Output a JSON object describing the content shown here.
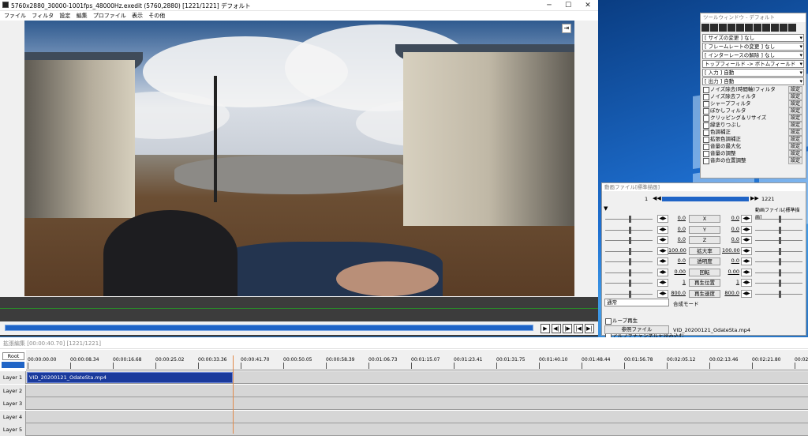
{
  "main": {
    "title": "5760x2880_30000-1001fps_48000Hz.exedit (5760,2880)  [1221/1221]  デフォルト",
    "menu": [
      "ファイル",
      "フィルタ",
      "設定",
      "編集",
      "プロファイル",
      "表示",
      "その他"
    ],
    "controls": {
      "minimize": "─",
      "maximize": "☐",
      "close": "✕"
    }
  },
  "toolwin": {
    "title": "ツールウィンドウ - デフォルト",
    "selects": [
      "[ サイズの変更 ]  なし",
      "[ フレームレートの変更 ]  なし",
      "[ インターレースの解除 ]  なし",
      "トップフィールド -> ボトムフィールド",
      "[ 入力 ]  自動",
      "[ 出力 ]  自動"
    ],
    "filters": [
      "ノイズ除去(時間軸)フィルタ",
      "ノイズ除去フィルタ",
      "シャープフィルタ",
      "ぼかしフィルタ",
      "クリッピング＆リサイズ",
      "縁塗りつぶし",
      "色調補正",
      "拡張色調補正",
      "音量の最大化",
      "音量の調整",
      "音声の位置調整"
    ],
    "set_label": "設定"
  },
  "objwin": {
    "title": "動画ファイル[標準描画]",
    "frame_start": "1",
    "frame_end": "1221",
    "check_label": "動画ファイル[標準描画]",
    "params": [
      {
        "label": "X",
        "left": "0.0",
        "right": "0.0"
      },
      {
        "label": "Y",
        "left": "0.0",
        "right": "0.0"
      },
      {
        "label": "Z",
        "left": "0.0",
        "right": "0.0"
      },
      {
        "label": "拡大率",
        "left": "100.00",
        "right": "100.00"
      },
      {
        "label": "透明度",
        "left": "0.0",
        "right": "0.0"
      },
      {
        "label": "回転",
        "left": "0.00",
        "right": "0.00"
      },
      {
        "label": "再生位置",
        "left": "1",
        "right": "1"
      },
      {
        "label": "再生速度",
        "left": "800.0",
        "right": "800.0"
      }
    ],
    "blend": "通常",
    "blend_label": "合成モード",
    "loop": "ループ再生",
    "alpha": "アルファチャンネルを読み込む",
    "ref_btn": "参照ファイル",
    "file": "VID_20200121_OdateSta.mp4"
  },
  "exedit": {
    "title": "拡張編集  [00:00:40.70]  [1221/1221]",
    "root": "Root",
    "ticks": [
      "00:00:00.00",
      "00:00:08.34",
      "00:00:16.68",
      "00:00:25.02",
      "00:00:33.36",
      "00:00:41.70",
      "00:00:50.05",
      "00:00:58.39",
      "00:01:06.73",
      "00:01:15.07",
      "00:01:23.41",
      "00:01:31.75",
      "00:01:40.10",
      "00:01:48.44",
      "00:01:56.78",
      "00:02:05.12",
      "00:02:13.46",
      "00:02:21.80",
      "00:02"
    ],
    "layers": [
      "Layer 1",
      "Layer 2",
      "Layer 3",
      "Layer 4",
      "Layer 5"
    ],
    "clip": "VID_20200121_OdateSta.mp4"
  }
}
